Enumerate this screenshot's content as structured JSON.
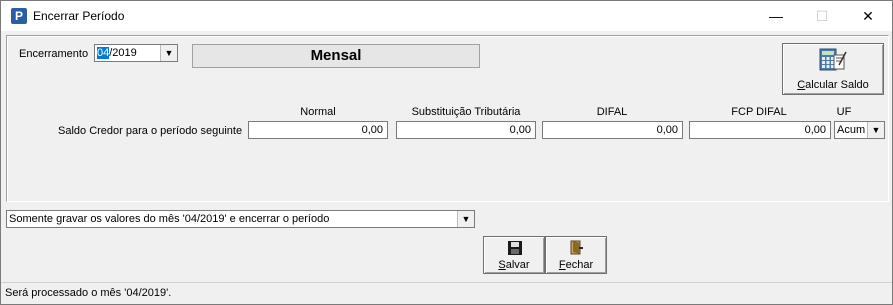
{
  "window": {
    "title": "Encerrar Período",
    "app_icon": "P",
    "minimize": "—",
    "maximize": "☐",
    "close": "✕"
  },
  "encerramento": {
    "label": "Encerramento",
    "value_selected": "04",
    "value_rest": "/2019"
  },
  "period_type": "Mensal",
  "calcular_saldo": {
    "label_u": "C",
    "label_rest": "alcular Saldo",
    "icon": "calculator-icon"
  },
  "columns": {
    "normal": "Normal",
    "st": "Substituição Tributária",
    "difal": "DIFAL",
    "fcp": "FCP DIFAL",
    "uf": "UF"
  },
  "row_label": "Saldo Credor para o período seguinte",
  "values": {
    "normal": "0,00",
    "st": "0,00",
    "difal": "0,00",
    "fcp": "0,00",
    "uf": "Acum"
  },
  "action_select": "Somente gravar os valores do mês '04/2019' e encerrar o período",
  "buttons": {
    "salvar_u": "S",
    "salvar_rest": "alvar",
    "fechar_u": "F",
    "fechar_rest": "echar"
  },
  "status": "Será processado o mês '04/2019'."
}
